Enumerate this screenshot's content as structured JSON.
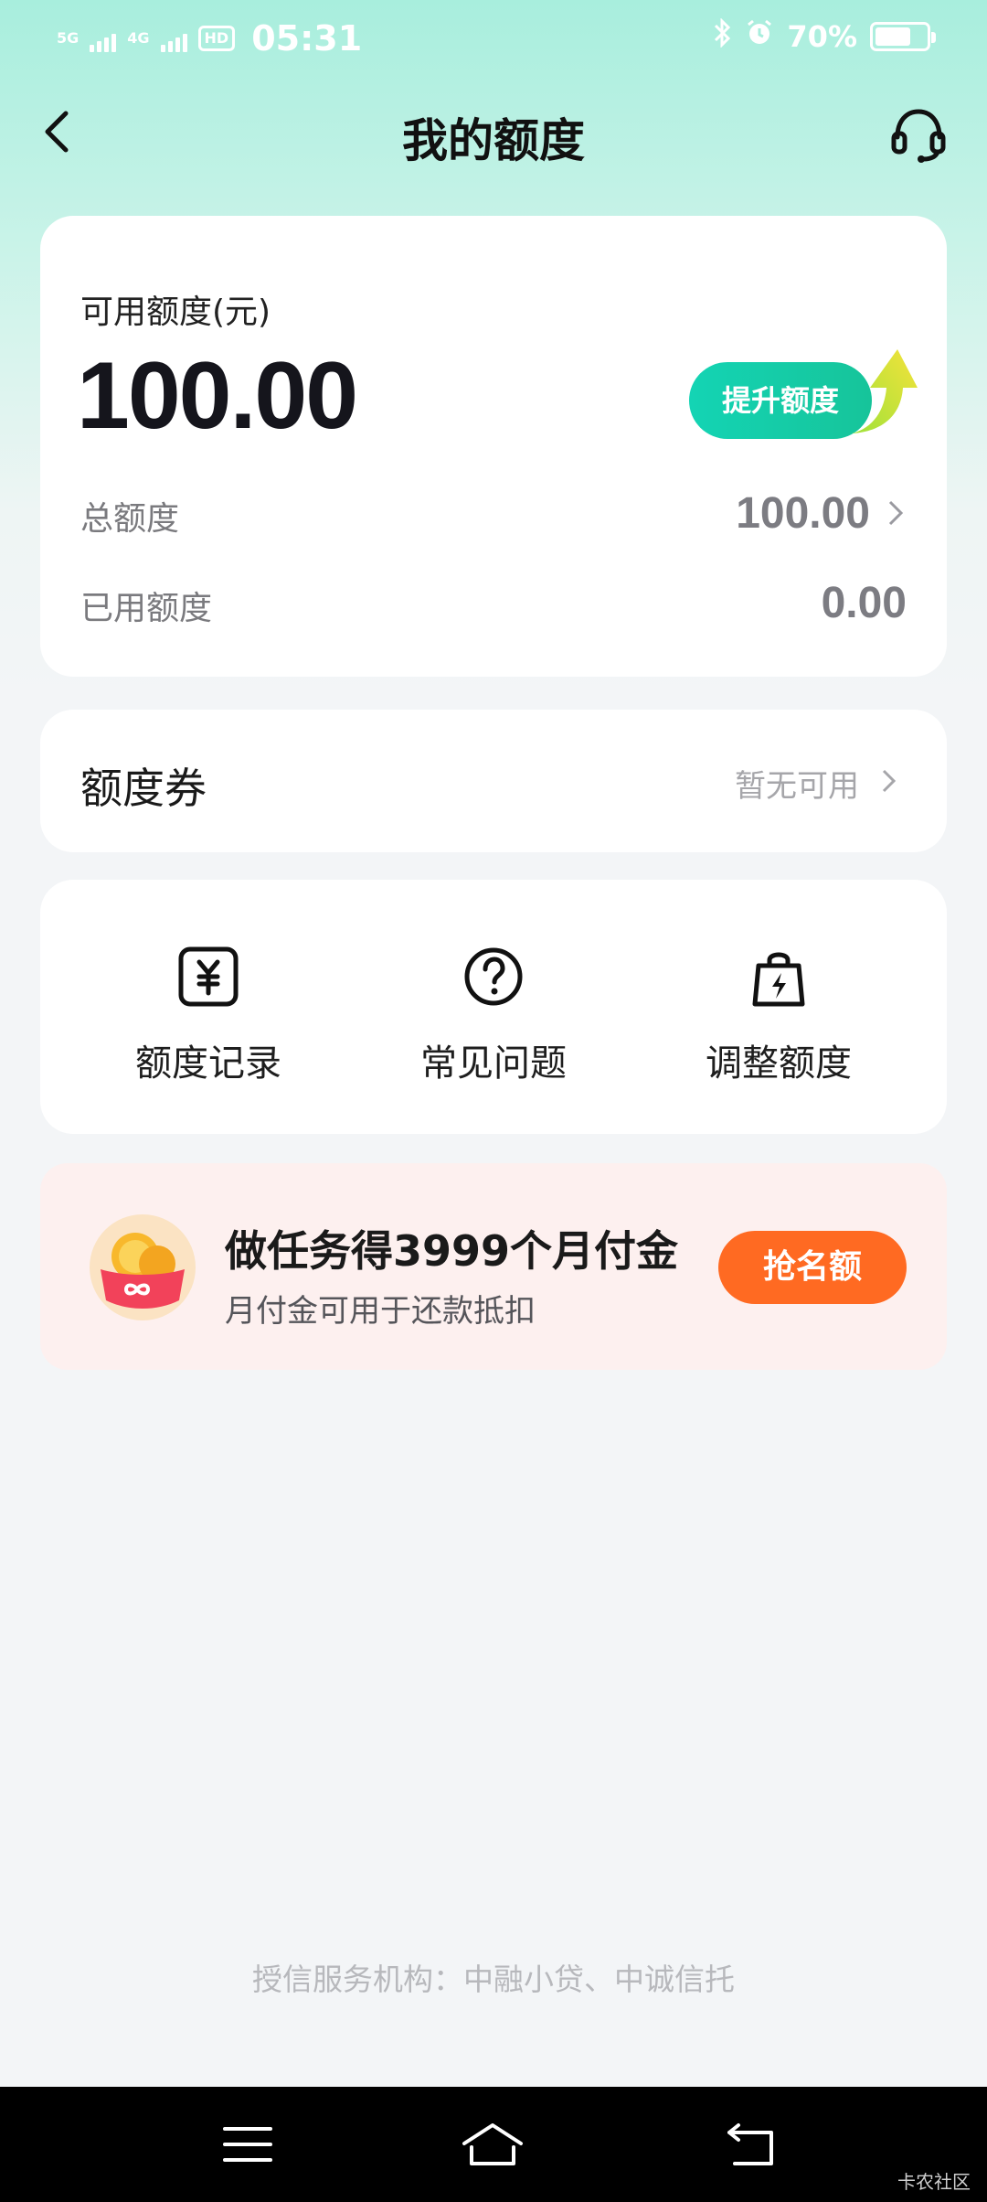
{
  "status_bar": {
    "network_1": "5G",
    "network_2": "4G",
    "hd_label": "HD",
    "time": "05:31",
    "battery_text": "70%",
    "battery_level": 0.7
  },
  "header": {
    "title": "我的额度",
    "back_icon": "chevron-left-icon",
    "service_icon": "headset-icon"
  },
  "credit": {
    "available_label": "可用额度(元)",
    "available_amount": "100.00",
    "raise_button_label": "提升额度",
    "total_label": "总额度",
    "total_value": "100.00",
    "used_label": "已用额度",
    "used_value": "0.00"
  },
  "coupon": {
    "title": "额度券",
    "status": "暂无可用"
  },
  "shortcuts": [
    {
      "label": "额度记录",
      "icon": "yuan-record-icon"
    },
    {
      "label": "常见问题",
      "icon": "question-circle-icon"
    },
    {
      "label": "调整额度",
      "icon": "bag-lightning-icon"
    }
  ],
  "promo": {
    "title": "做任务得3999个月付金",
    "subtitle": "月付金可用于还款抵扣",
    "button_label": "抢名额",
    "icon": "gold-coin-wallet-icon"
  },
  "footer_note": "授信服务机构：中融小贷、中诚信托",
  "watermark": "卡农社区",
  "colors": {
    "accent_green": "#14d4b4",
    "promo_orange": "#ff6a22",
    "promo_bg": "#fdf0ef"
  }
}
